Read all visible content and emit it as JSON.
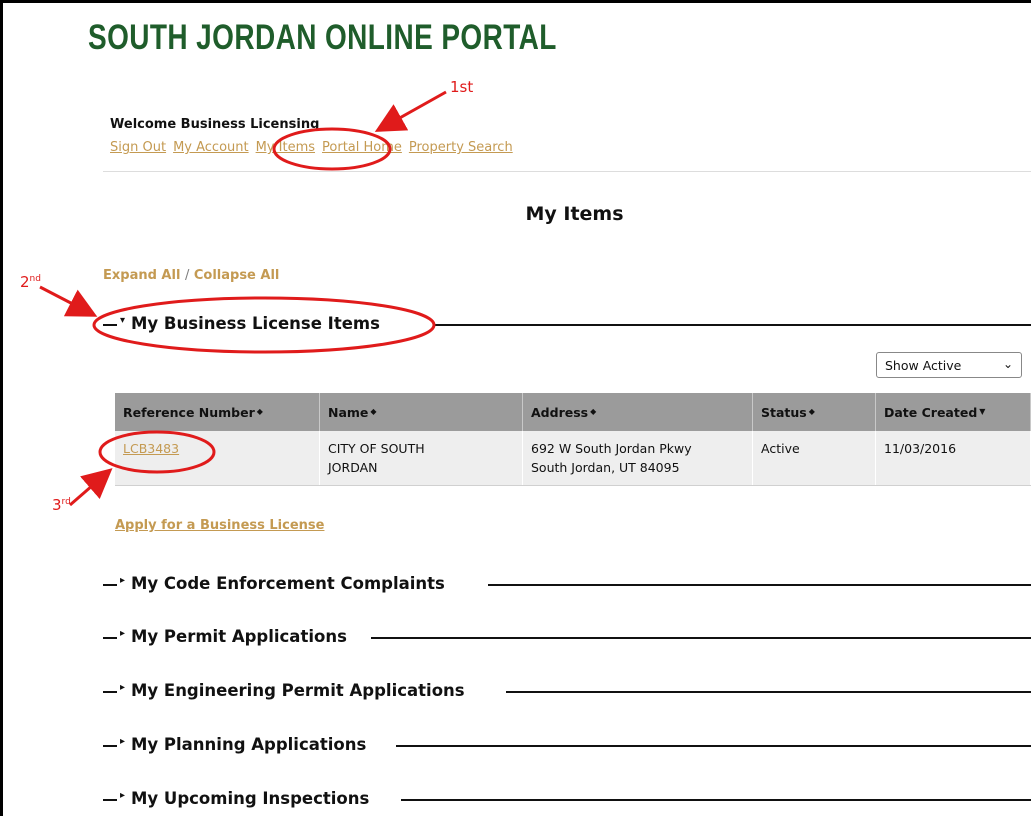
{
  "portal_title": "SOUTH JORDAN ONLINE PORTAL",
  "welcome": "Welcome Business Licensing",
  "nav": [
    "Sign Out",
    "My Account",
    "My Items",
    "Portal Home",
    "Property Search"
  ],
  "page_title": "My Items",
  "expand_all": "Expand All",
  "separator": "/",
  "collapse_all": "Collapse All",
  "sections": {
    "business": "My Business License Items",
    "code": "My Code Enforcement Complaints",
    "permit": "My Permit Applications",
    "engineering": "My Engineering Permit Applications",
    "planning": "My Planning Applications",
    "inspections": "My Upcoming Inspections"
  },
  "filter": {
    "selected": "Show Active"
  },
  "table": {
    "headers": [
      "Reference Number",
      "Name",
      "Address",
      "Status",
      "Date Created"
    ],
    "rows": [
      {
        "reference": "LCB3483",
        "name_line1": "CITY OF SOUTH",
        "name_line2": "JORDAN",
        "address_line1": "692 W South Jordan Pkwy",
        "address_line2": "South Jordan, UT 84095",
        "status": "Active",
        "date_created": "11/03/2016"
      }
    ]
  },
  "apply_link": "Apply for a Business License",
  "annotations": {
    "first": "1st",
    "second": "2",
    "second_sup": "nd",
    "third": "3",
    "third_sup": "rd"
  },
  "colors": {
    "title_green": "#1f5d2b",
    "link_gold": "#c49a52",
    "annotation_red": "#e01b1b",
    "header_gray": "#9b9b9b"
  }
}
